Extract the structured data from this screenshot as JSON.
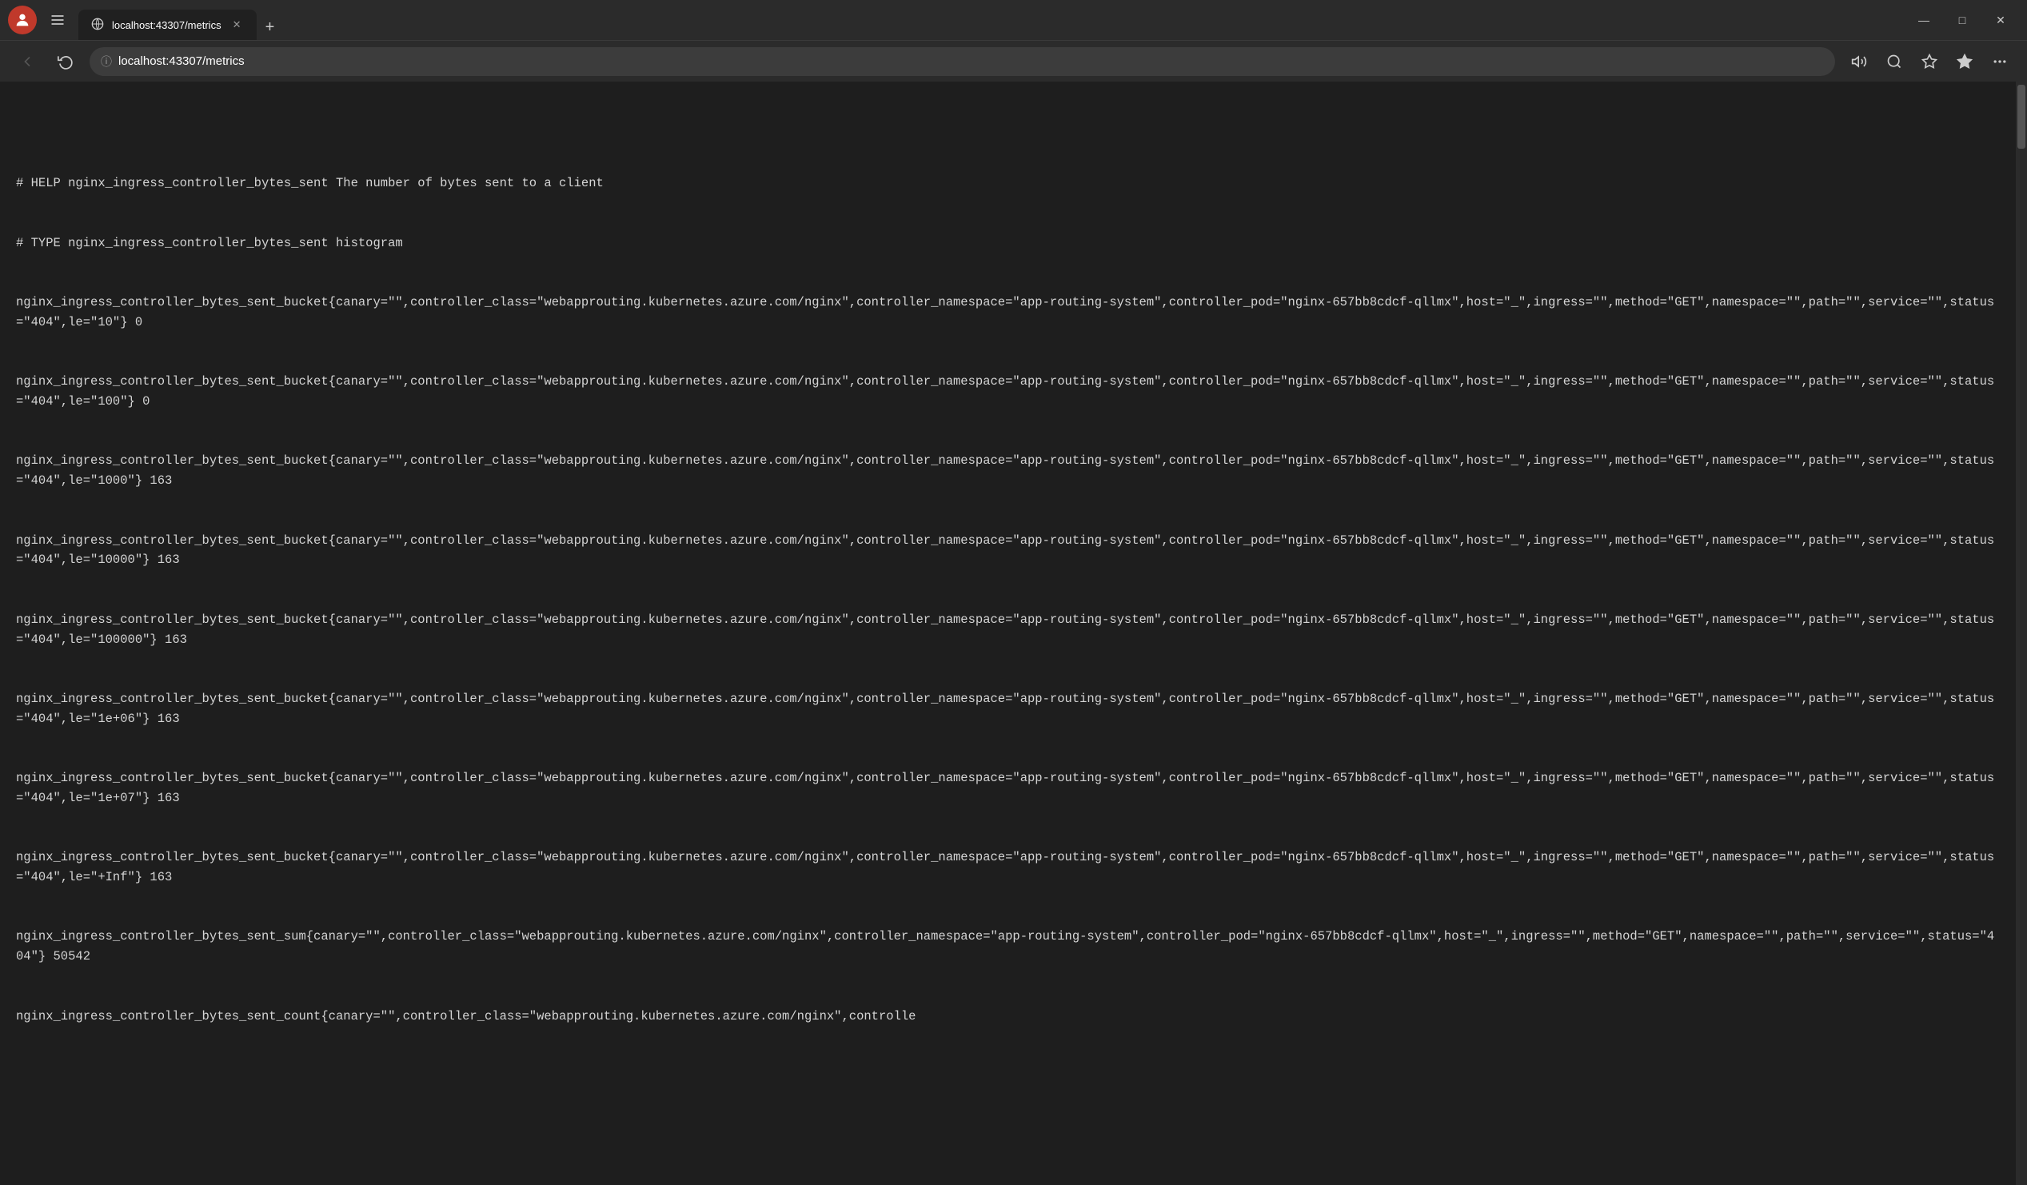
{
  "titlebar": {
    "profile_icon": "👤",
    "sidebar_icon": "☰",
    "tab": {
      "favicon": "🌐",
      "title": "localhost:43307/metrics",
      "close_icon": "✕"
    },
    "new_tab_icon": "+",
    "controls": {
      "minimize": "—",
      "maximize": "□",
      "close": "✕"
    }
  },
  "addressbar": {
    "back_icon": "←",
    "refresh_icon": "↻",
    "lock_icon": "ⓘ",
    "url": "localhost:43307/metrics",
    "read_aloud_icon": "🔊",
    "zoom_icon": "🔍",
    "favorites_icon": "☆",
    "collections_icon": "⭐",
    "more_icon": "…"
  },
  "content": {
    "lines": [
      "# HELP nginx_ingress_controller_bytes_sent The number of bytes sent to a client",
      "# TYPE nginx_ingress_controller_bytes_sent histogram",
      "nginx_ingress_controller_bytes_sent_bucket{canary=\"\",controller_class=\"webapprouting.kubernetes.azure.com/nginx\",controller_namespace=\"app-routing-system\",controller_pod=\"nginx-657bb8cdcf-qllmx\",host=\"_\",ingress=\"\",method=\"GET\",namespace=\"\",path=\"\",service=\"\",status=\"404\",le=\"10\"} 0",
      "nginx_ingress_controller_bytes_sent_bucket{canary=\"\",controller_class=\"webapprouting.kubernetes.azure.com/nginx\",controller_namespace=\"app-routing-system\",controller_pod=\"nginx-657bb8cdcf-qllmx\",host=\"_\",ingress=\"\",method=\"GET\",namespace=\"\",path=\"\",service=\"\",status=\"404\",le=\"100\"} 0",
      "nginx_ingress_controller_bytes_sent_bucket{canary=\"\",controller_class=\"webapprouting.kubernetes.azure.com/nginx\",controller_namespace=\"app-routing-system\",controller_pod=\"nginx-657bb8cdcf-qllmx\",host=\"_\",ingress=\"\",method=\"GET\",namespace=\"\",path=\"\",service=\"\",status=\"404\",le=\"1000\"} 163",
      "nginx_ingress_controller_bytes_sent_bucket{canary=\"\",controller_class=\"webapprouting.kubernetes.azure.com/nginx\",controller_namespace=\"app-routing-system\",controller_pod=\"nginx-657bb8cdcf-qllmx\",host=\"_\",ingress=\"\",method=\"GET\",namespace=\"\",path=\"\",service=\"\",status=\"404\",le=\"10000\"} 163",
      "nginx_ingress_controller_bytes_sent_bucket{canary=\"\",controller_class=\"webapprouting.kubernetes.azure.com/nginx\",controller_namespace=\"app-routing-system\",controller_pod=\"nginx-657bb8cdcf-qllmx\",host=\"_\",ingress=\"\",method=\"GET\",namespace=\"\",path=\"\",service=\"\",status=\"404\",le=\"100000\"} 163",
      "nginx_ingress_controller_bytes_sent_bucket{canary=\"\",controller_class=\"webapprouting.kubernetes.azure.com/nginx\",controller_namespace=\"app-routing-system\",controller_pod=\"nginx-657bb8cdcf-qllmx\",host=\"_\",ingress=\"\",method=\"GET\",namespace=\"\",path=\"\",service=\"\",status=\"404\",le=\"1e+06\"} 163",
      "nginx_ingress_controller_bytes_sent_bucket{canary=\"\",controller_class=\"webapprouting.kubernetes.azure.com/nginx\",controller_namespace=\"app-routing-system\",controller_pod=\"nginx-657bb8cdcf-qllmx\",host=\"_\",ingress=\"\",method=\"GET\",namespace=\"\",path=\"\",service=\"\",status=\"404\",le=\"1e+07\"} 163",
      "nginx_ingress_controller_bytes_sent_bucket{canary=\"\",controller_class=\"webapprouting.kubernetes.azure.com/nginx\",controller_namespace=\"app-routing-system\",controller_pod=\"nginx-657bb8cdcf-qllmx\",host=\"_\",ingress=\"\",method=\"GET\",namespace=\"\",path=\"\",service=\"\",status=\"404\",le=\"+Inf\"} 163",
      "nginx_ingress_controller_bytes_sent_sum{canary=\"\",controller_class=\"webapprouting.kubernetes.azure.com/nginx\",controller_namespace=\"app-routing-system\",controller_pod=\"nginx-657bb8cdcf-qllmx\",host=\"_\",ingress=\"\",method=\"GET\",namespace=\"\",path=\"\",service=\"\",status=\"404\"} 50542",
      "nginx_ingress_controller_bytes_sent_count{canary=\"\",controller_class=\"webapprouting.kubernetes.azure.com/nginx\",controlle"
    ]
  }
}
